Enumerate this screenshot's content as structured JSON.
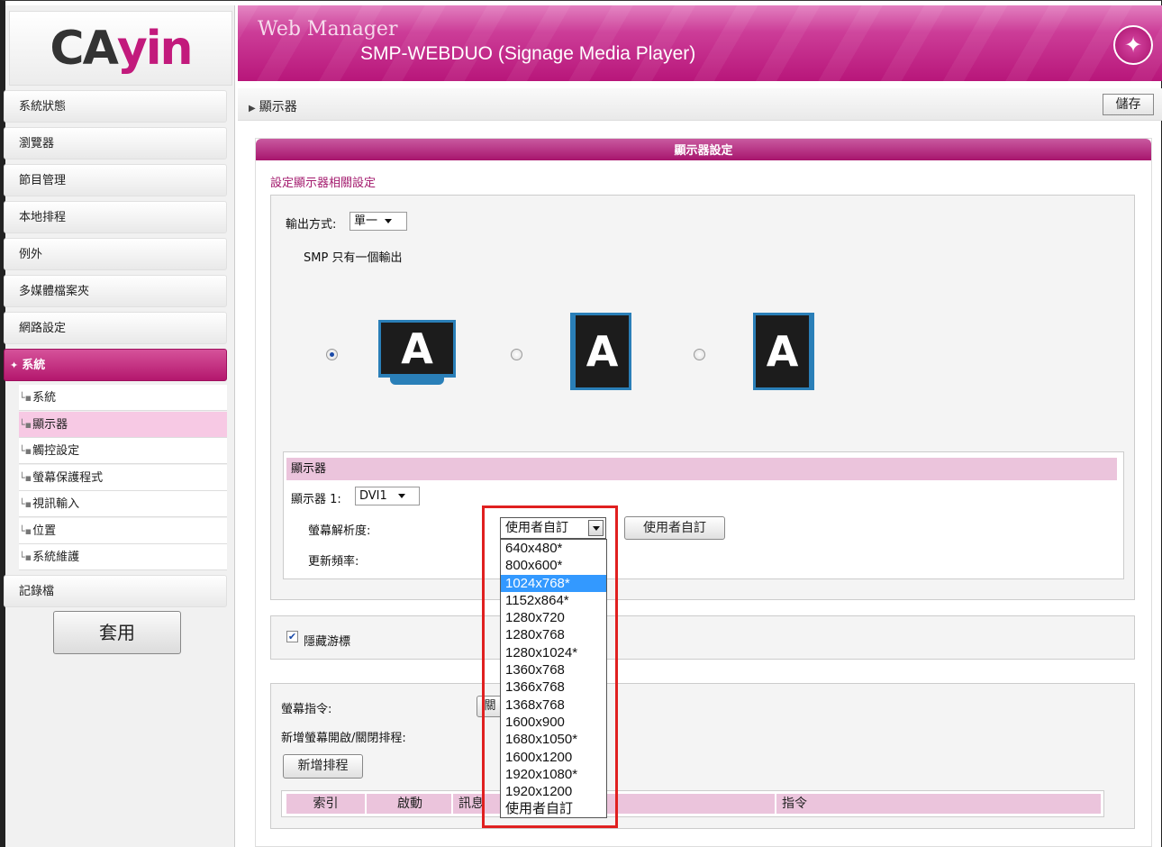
{
  "header": {
    "title": "Web Manager",
    "subtitle": "SMP-WEBDUO (Signage Media Player)",
    "logo_text": "CAYIN"
  },
  "sidebar": {
    "items": [
      {
        "label": "系統狀態"
      },
      {
        "label": "瀏覽器"
      },
      {
        "label": "節目管理"
      },
      {
        "label": "本地排程"
      },
      {
        "label": "例外"
      },
      {
        "label": "多媒體檔案夾"
      },
      {
        "label": "網路設定"
      },
      {
        "label": "系統",
        "active": true
      },
      {
        "label": "記錄檔"
      }
    ],
    "subitems": [
      {
        "label": "系統"
      },
      {
        "label": "顯示器",
        "selected": true
      },
      {
        "label": "觸控設定"
      },
      {
        "label": "螢幕保護程式"
      },
      {
        "label": "視訊輸入"
      },
      {
        "label": "位置"
      },
      {
        "label": "系統維護"
      }
    ],
    "apply_label": "套用"
  },
  "breadcrumb": "顯示器",
  "save_label": "儲存",
  "panel": {
    "title": "顯示器設定",
    "description": "設定顯示器相關設定",
    "output_label": "輸出方式:",
    "output_value": "單一",
    "output_note": "SMP 只有一個輸出",
    "monitor_letter": "A",
    "display_section": {
      "header": "顯示器",
      "display1_label": "顯示器 1:",
      "display1_value": "DVI1",
      "resolution_label": "螢幕解析度:",
      "resolution_value": "使用者自訂",
      "custom_button": "使用者自訂",
      "refresh_label": "更新頻率:"
    },
    "hide_cursor_label": "隱藏游標",
    "hide_cursor_checked": true,
    "screen_cmd_label": "螢幕指令:",
    "screen_cmd_button": "關",
    "schedule_label": "新增螢幕開啟/關閉排程:",
    "add_schedule_button": "新增排程",
    "table_headers": [
      "索引",
      "啟動",
      "訊息",
      "指令"
    ]
  },
  "resolution_options": [
    "640x480*",
    "800x600*",
    "1024x768*",
    "1152x864*",
    "1280x720",
    "1280x768",
    "1280x1024*",
    "1360x768",
    "1366x768",
    "1368x768",
    "1600x900",
    "1680x1050*",
    "1600x1200",
    "1920x1080*",
    "1920x1200",
    "使用者自訂"
  ],
  "resolution_highlight": "1024x768*",
  "colors": {
    "accent": "#b8167a",
    "highlight": "#3399ff",
    "annotation_red": "#e02020"
  }
}
